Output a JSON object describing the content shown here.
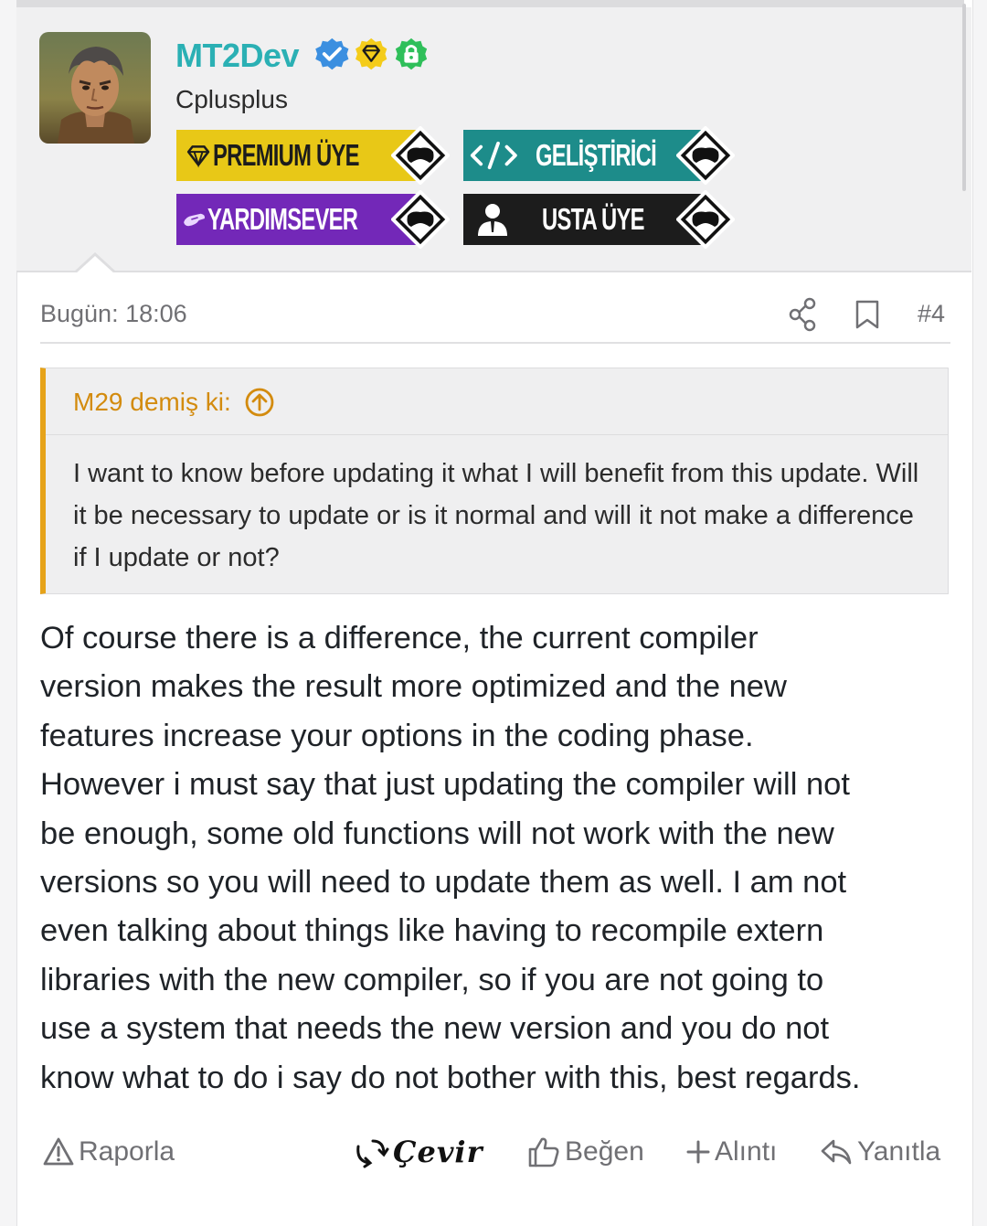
{
  "user": {
    "name": "MT2Dev",
    "title": "Cplusplus"
  },
  "badges": [
    {
      "label": "PREMIUM ÜYE",
      "color": "#e8c817"
    },
    {
      "label": "GELİŞTİRİCİ",
      "color": "#1d8c8a"
    },
    {
      "label": "YARDIMSEVER",
      "color": "#7328b8"
    },
    {
      "label": "USTA ÜYE",
      "color": "#1c1c1c"
    }
  ],
  "meta": {
    "date": "Bugün: 18:06",
    "post_number": "#4"
  },
  "quote": {
    "author_line": "M29 demiş ki:",
    "text": "I want to know before updating it what I will benefit from this update. Will it be necessary to update or is it normal and will it not make a difference if I update or not?"
  },
  "post": {
    "lines": [
      "Of course there is a difference, the current compiler",
      "version makes the result more optimized and the new",
      "features increase your options in the coding phase.",
      "However i must say that just updating the compiler will not",
      "be enough, some old functions will not work with the new",
      "versions so you will need to update them as well. I am not",
      "even talking about things like having to recompile extern",
      "libraries with the new compiler, so if you are not going to",
      "use a system that needs the new version and you do not",
      "know what to do i say do not bother with this, best regards."
    ]
  },
  "actions": {
    "report": "Raporla",
    "translate": "Çevir",
    "like": "Beğen",
    "quote": "Alıntı",
    "reply": "Yanıtla"
  },
  "colors": {
    "accent_username": "#2bb0b4",
    "quote_border": "#e6a31a",
    "verified": "#3b8fe0",
    "lock_badge": "#2fbf5a",
    "diamond_badge": "#f4cc1a"
  }
}
